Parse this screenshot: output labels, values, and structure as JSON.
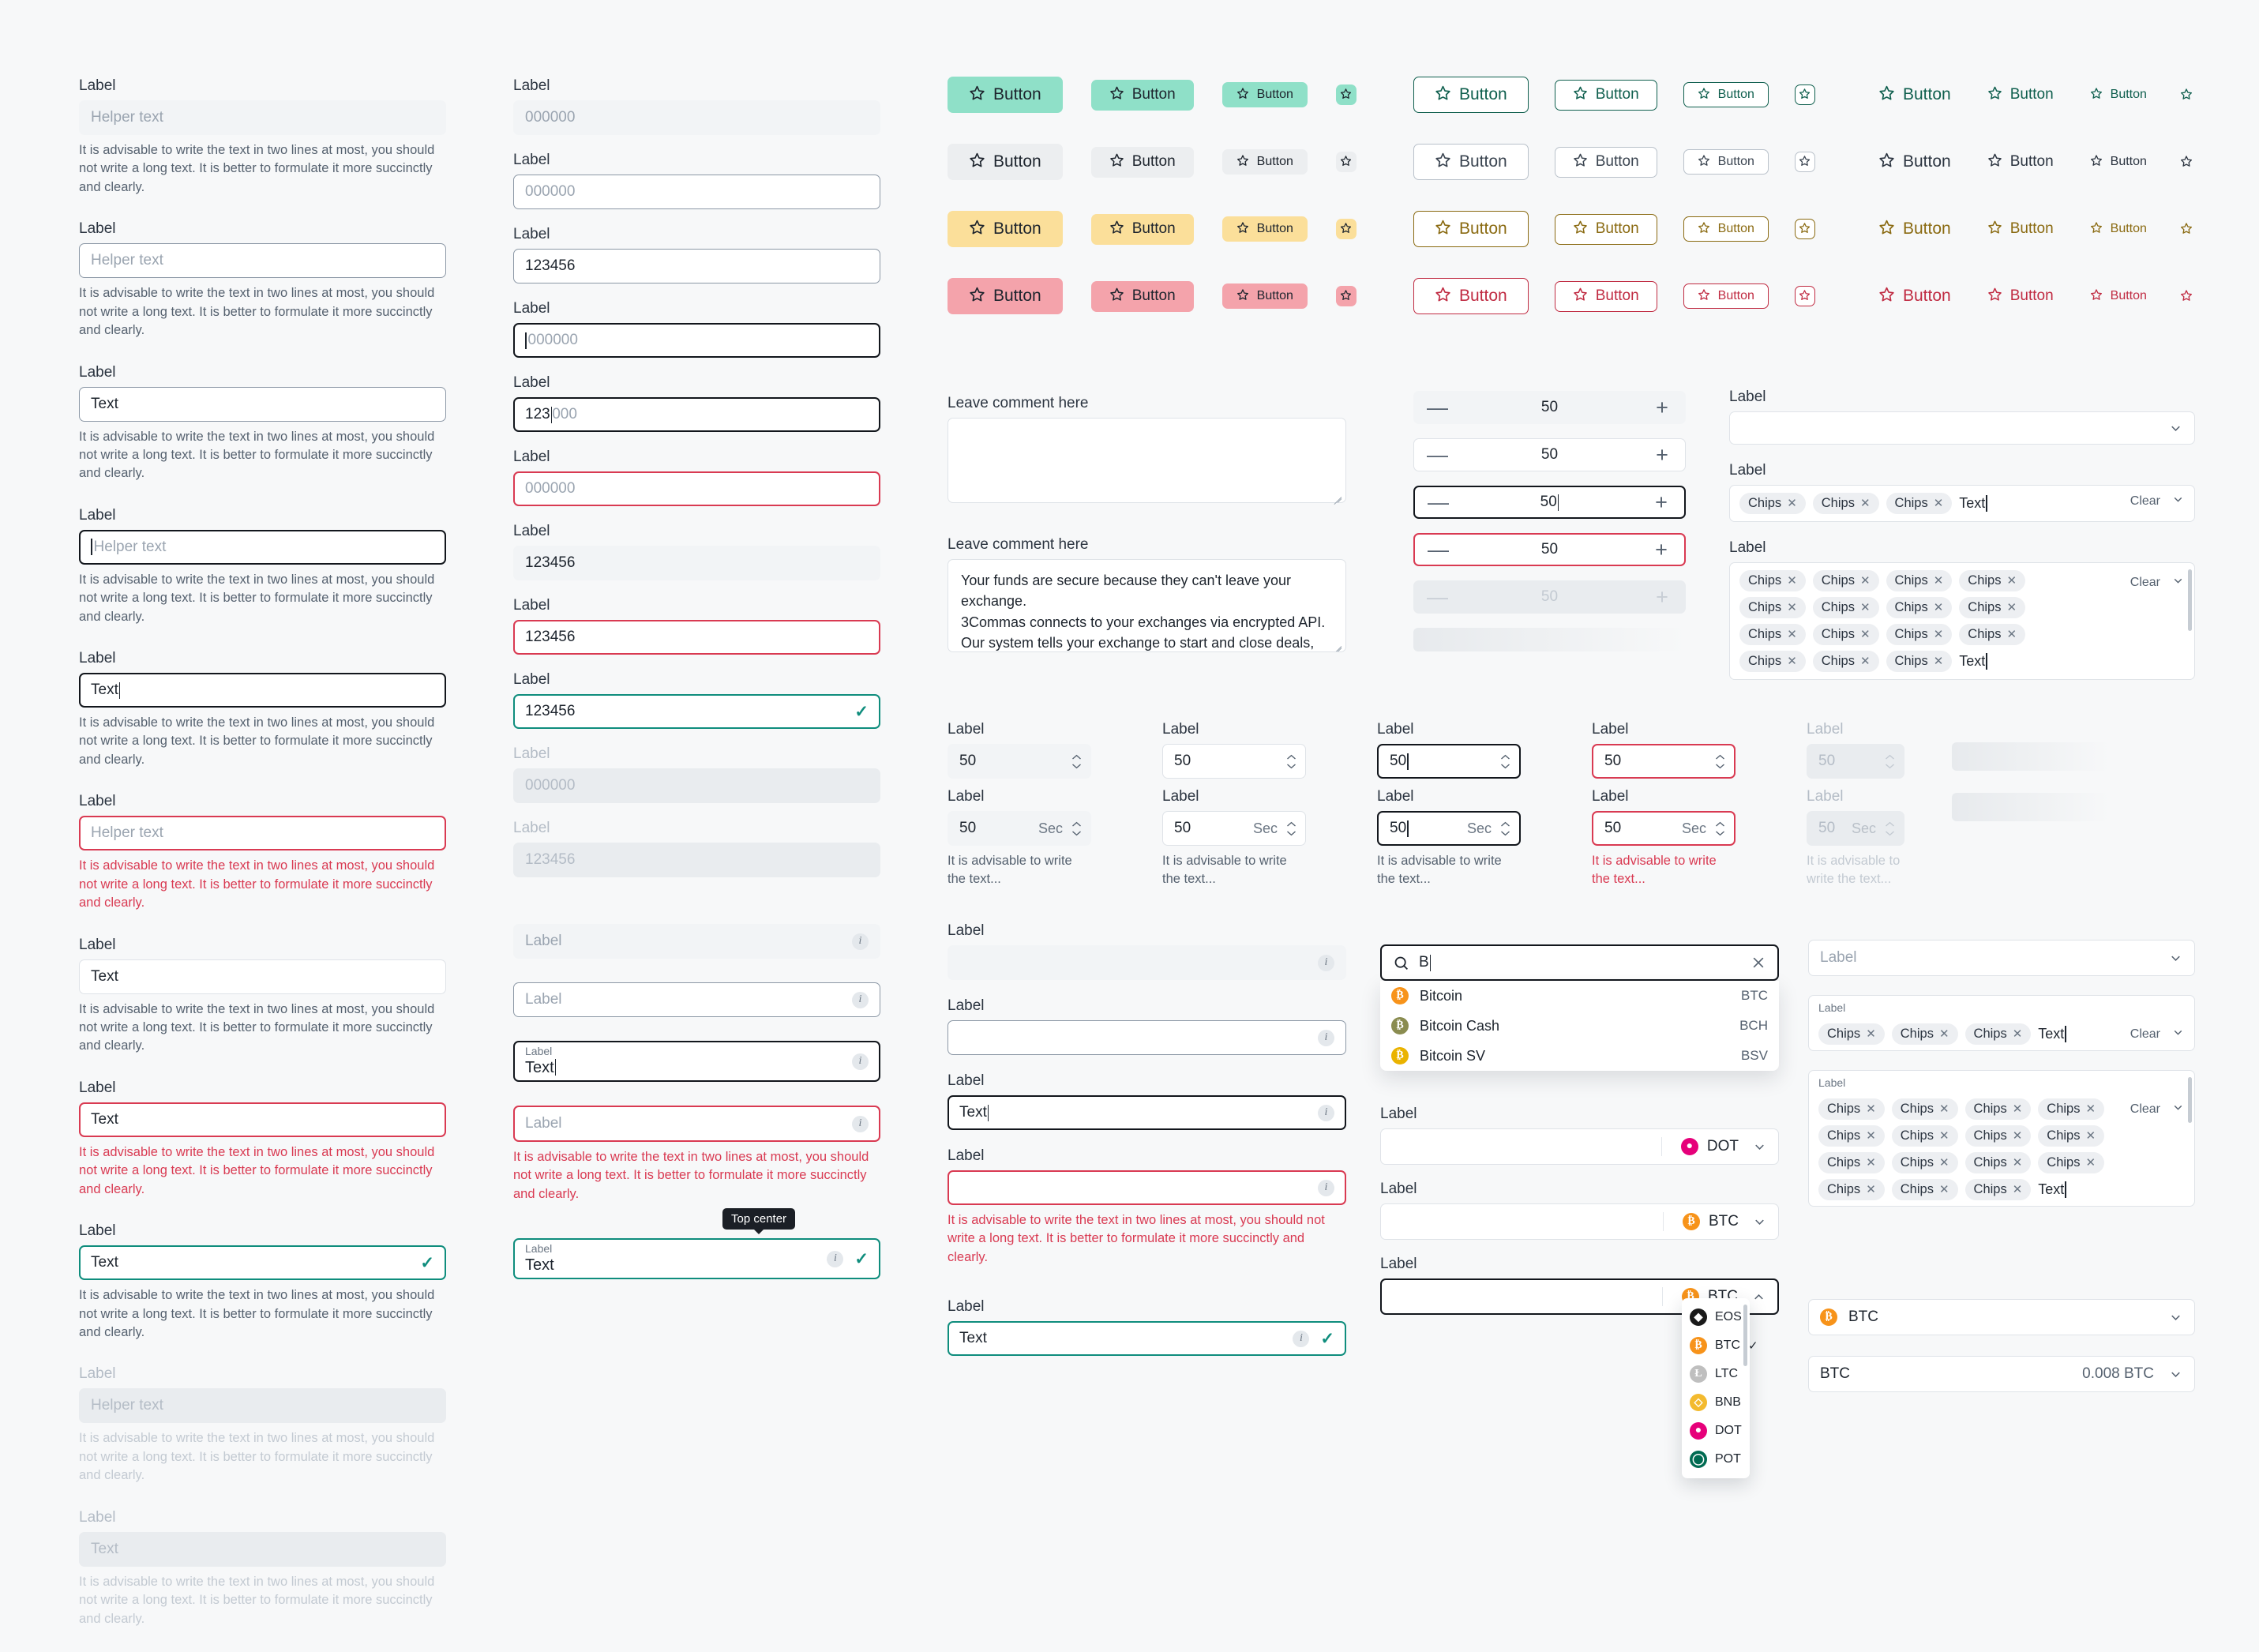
{
  "common": {
    "label": "Label",
    "helper_placeholder": "Helper text",
    "text_value": "Text",
    "helper_note": "It is advisable to write the text in two lines at most, you should not write a long text. It is better to formulate it more succinctly and clearly.",
    "helper_note_short": "It is advisable to write the text...",
    "clear": "Clear",
    "chip": "Chips",
    "close_x": "✕",
    "check": "✓",
    "info": "i"
  },
  "column_text_fields": {
    "fields": [
      {
        "label": "Label",
        "value": "Helper text",
        "state": "flat",
        "placeholder": true
      },
      {
        "label": "Label",
        "value": "Helper text",
        "state": "hover",
        "placeholder": true
      },
      {
        "label": "Label",
        "value": "Text",
        "state": "hover",
        "placeholder": false
      },
      {
        "label": "Label",
        "value": "Helper text",
        "state": "focus",
        "placeholder": true
      },
      {
        "label": "Label",
        "value": "Text",
        "state": "focus",
        "placeholder": false
      },
      {
        "label": "Label",
        "value": "Helper text",
        "state": "error",
        "placeholder": true
      },
      {
        "label": "Label",
        "value": "Text",
        "state": "hover",
        "placeholder": false
      },
      {
        "label": "Label",
        "value": "Text",
        "state": "error",
        "placeholder": false
      },
      {
        "label": "Label",
        "value": "Text",
        "state": "success",
        "placeholder": false
      },
      {
        "label": "Label",
        "value": "Helper text",
        "state": "disabled",
        "placeholder": true
      },
      {
        "label": "Label",
        "value": "Text",
        "state": "disabled",
        "placeholder": false
      }
    ]
  },
  "column_number_fields": {
    "fields": [
      {
        "label": "Label",
        "value": "000000",
        "state": "flat",
        "placeholder": true
      },
      {
        "label": "Label",
        "value": "000000",
        "state": "hover",
        "placeholder": true
      },
      {
        "label": "Label",
        "value": "123456",
        "state": "hover",
        "placeholder": false
      },
      {
        "label": "Label",
        "value": "000000",
        "state": "focus",
        "placeholder": true
      },
      {
        "label": "Label",
        "value": "123000",
        "state": "focus-mid",
        "placeholder": false
      },
      {
        "label": "Label",
        "value": "000000",
        "state": "error",
        "placeholder": true
      },
      {
        "label": "Label",
        "value": "123456",
        "state": "flat",
        "placeholder": false
      },
      {
        "label": "Label",
        "value": "123456",
        "state": "error",
        "placeholder": false
      },
      {
        "label": "Label",
        "value": "123456",
        "state": "success",
        "placeholder": false
      },
      {
        "label": "Label",
        "value": "000000",
        "state": "disabled",
        "placeholder": true
      },
      {
        "label": "Label",
        "value": "123456",
        "state": "disabled",
        "placeholder": false
      }
    ]
  },
  "column_float_label_fields": {
    "fields": [
      {
        "label": "Label",
        "value": "",
        "state": "flat"
      },
      {
        "label": "Label",
        "value": "",
        "state": "hover"
      },
      {
        "label": "Label",
        "value": "Text",
        "state": "focus"
      },
      {
        "label": "Label",
        "value": "",
        "state": "error"
      },
      {
        "label": "Label",
        "value": "Text",
        "state": "success"
      }
    ],
    "tooltip": "Top center"
  },
  "column_info_fields": {
    "fields": [
      {
        "label": "Label",
        "value": "",
        "state": "flat"
      },
      {
        "label": "Label",
        "value": "",
        "state": "hover"
      },
      {
        "label": "Label",
        "value": "Text",
        "state": "focus"
      },
      {
        "label": "Label",
        "value": "",
        "state": "error"
      },
      {
        "label": "Label",
        "value": "Text",
        "state": "success"
      }
    ]
  },
  "buttons": {
    "label": "Button",
    "star_icon": "star-icon",
    "rows": [
      {
        "tone": "green",
        "fill": "#8fe0c8",
        "outline": "#0f5f4e",
        "text": "#0f5f4e"
      },
      {
        "tone": "gray",
        "fill": "#eceef0",
        "outline": "#b9c1ca",
        "text": "#2b3440"
      },
      {
        "tone": "amber",
        "fill": "#fbdf9a",
        "outline": "#8a6a11",
        "text": "#8a6a11"
      },
      {
        "tone": "red",
        "fill": "#f4a3ab",
        "outline": "#c02b42",
        "text": "#c02b42"
      }
    ],
    "sizes": [
      "large",
      "medium",
      "small",
      "icon"
    ]
  },
  "textareas": [
    {
      "label": "Leave comment here",
      "value": ""
    },
    {
      "label": "Leave comment here",
      "value": "Your funds are secure because they can't leave your exchange.\n3Commas connects to your exchanges via encrypted API. Our system tells your exchange to start and close deals, but has zero access to withdraw or transfer fiat or crypto currencies.\nEven better, since 3Commas connects via API , your log-in for yo"
    }
  ],
  "steppers": [
    {
      "value": "50",
      "state": "flat",
      "minus": "—",
      "plus": "+"
    },
    {
      "value": "50",
      "state": "hover",
      "minus": "—",
      "plus": "+"
    },
    {
      "value": "50",
      "state": "focus",
      "minus": "—",
      "plus": "+"
    },
    {
      "value": "50",
      "state": "error",
      "minus": "—",
      "plus": "+"
    },
    {
      "value": "50",
      "state": "disabled",
      "minus": "—",
      "plus": "+"
    },
    {
      "value": "",
      "state": "skeleton",
      "minus": "",
      "plus": ""
    }
  ],
  "spinners": {
    "unit": "Sec",
    "columns": [
      {
        "label": "Label",
        "value": "50",
        "state": "flat",
        "help": "It is advisable to write the text...",
        "help_state": "normal"
      },
      {
        "label": "Label",
        "value": "50",
        "state": "hover",
        "help": "It is advisable to write the text...",
        "help_state": "normal"
      },
      {
        "label": "Label",
        "value": "50",
        "state": "focus",
        "help": "It is advisable to write the text...",
        "help_state": "normal"
      },
      {
        "label": "Label",
        "value": "50",
        "state": "error",
        "help": "It is advisable to write the text...",
        "help_state": "error"
      },
      {
        "label": "Label",
        "value": "50",
        "state": "disabled",
        "help": "It is advisable to write the text...",
        "help_state": "disabled"
      },
      {
        "label": "",
        "value": "",
        "state": "skeleton",
        "help": "",
        "help_state": "none"
      }
    ]
  },
  "chip_selects": {
    "empty_select": {
      "label": "Label",
      "value": ""
    },
    "single_row": {
      "label": "Label",
      "chips": [
        "Chips",
        "Chips",
        "Chips"
      ],
      "text": "Text",
      "clear": "Clear"
    },
    "multi_row": {
      "label": "Label",
      "chips": [
        "Chips",
        "Chips",
        "Chips",
        "Chips",
        "Chips",
        "Chips",
        "Chips",
        "Chips",
        "Chips",
        "Chips",
        "Chips",
        "Chips",
        "Chips",
        "Chips",
        "Chips"
      ],
      "text": "Text",
      "clear": "Clear"
    }
  },
  "float_chip_selects": {
    "empty_select": {
      "label": "Label"
    },
    "single_row": {
      "label": "Label",
      "chips": [
        "Chips",
        "Chips",
        "Chips"
      ],
      "text": "Text",
      "clear": "Clear"
    },
    "multi_row": {
      "label": "Label",
      "chips": [
        "Chips",
        "Chips",
        "Chips",
        "Chips",
        "Chips",
        "Chips",
        "Chips",
        "Chips",
        "Chips",
        "Chips",
        "Chips",
        "Chips",
        "Chips",
        "Chips",
        "Chips"
      ],
      "text": "Text",
      "clear": "Clear"
    }
  },
  "search": {
    "query": "B",
    "search_icon": "search-icon",
    "clear_icon": "close-icon",
    "results": [
      {
        "name": "Bitcoin",
        "ticker": "BTC",
        "color": "#f7931a"
      },
      {
        "name": "Bitcoin Cash",
        "ticker": "BCH",
        "color": "#8a8c50"
      },
      {
        "name": "Bitcoin SV",
        "ticker": "BSV",
        "color": "#eab300"
      }
    ]
  },
  "coin_selects": [
    {
      "label": "Label",
      "ticker": "DOT",
      "color": "#e6007a",
      "glyph": "P",
      "state": "flat",
      "open": false
    },
    {
      "label": "Label",
      "ticker": "BTC",
      "color": "#f7931a",
      "glyph": "Ƀ",
      "state": "flat",
      "open": false
    },
    {
      "label": "Label",
      "ticker": "BTC",
      "color": "#f7931a",
      "glyph": "Ƀ",
      "state": "focus",
      "open": true
    }
  ],
  "coin_menu": {
    "items": [
      {
        "ticker": "EOS",
        "color": "#1a1a1a",
        "glyph": "◈",
        "selected": false
      },
      {
        "ticker": "BTC",
        "color": "#f7931a",
        "glyph": "Ƀ",
        "selected": true
      },
      {
        "ticker": "LTC",
        "color": "#bfbfbf",
        "glyph": "Ł",
        "selected": false
      },
      {
        "ticker": "BNB",
        "color": "#f3ba2f",
        "glyph": "◇",
        "selected": false
      },
      {
        "ticker": "DOT",
        "color": "#e6007a",
        "glyph": "P",
        "selected": false
      },
      {
        "ticker": "POT",
        "color": "#006b52",
        "glyph": "P",
        "selected": false
      }
    ],
    "check": "✓"
  },
  "bottom_selects": [
    {
      "type": "coin",
      "ticker": "BTC",
      "color": "#f7931a",
      "glyph": "Ƀ"
    },
    {
      "type": "amount",
      "left": "BTC",
      "right": "0.008 BTC"
    }
  ]
}
